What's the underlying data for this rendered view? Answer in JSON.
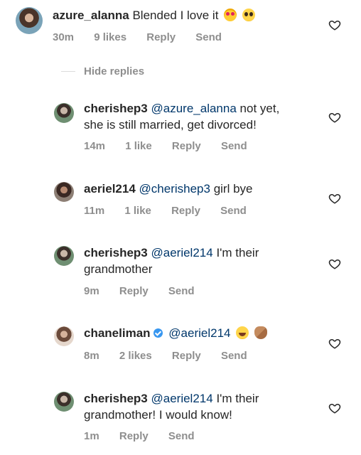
{
  "comments": [
    {
      "username": "azure_alanna",
      "text": "Blended I love it",
      "time": "30m",
      "likes": "9 likes",
      "reply": "Reply",
      "send": "Send"
    },
    {
      "username": "cherishep3",
      "mention": "@azure_alanna",
      "text_line1": "not yet,",
      "text_line2": "she is still married, get divorced!",
      "time": "14m",
      "likes": "1 like",
      "reply": "Reply",
      "send": "Send"
    },
    {
      "username": "aeriel214",
      "mention": "@cherishep3",
      "text": "girl bye",
      "time": "11m",
      "likes": "1 like",
      "reply": "Reply",
      "send": "Send"
    },
    {
      "username": "cherishep3",
      "mention": "@aeriel214",
      "text_line1": "I'm their",
      "text_line2": "grandmother",
      "time": "9m",
      "reply": "Reply",
      "send": "Send"
    },
    {
      "username": "chaneliman",
      "mention": "@aeriel214",
      "time": "8m",
      "likes": "2 likes",
      "reply": "Reply",
      "send": "Send"
    },
    {
      "username": "cherishep3",
      "mention": "@aeriel214",
      "text_line1": "I'm their",
      "text_line2": "grandmother! I would know!",
      "time": "1m",
      "reply": "Reply",
      "send": "Send"
    }
  ],
  "hide_replies": "Hide replies",
  "icons": {
    "heart": "heart-outline-icon",
    "verified": "verified-badge-icon",
    "emoji_1": "heart-eyes-emoji",
    "emoji_2": "pleading-face-emoji",
    "emoji_3": "tears-of-joy-emoji",
    "emoji_4": "clapping-hands-emoji"
  },
  "colors": {
    "mention": "#00376b",
    "meta": "#8e8e8e",
    "verified": "#3897f0"
  }
}
